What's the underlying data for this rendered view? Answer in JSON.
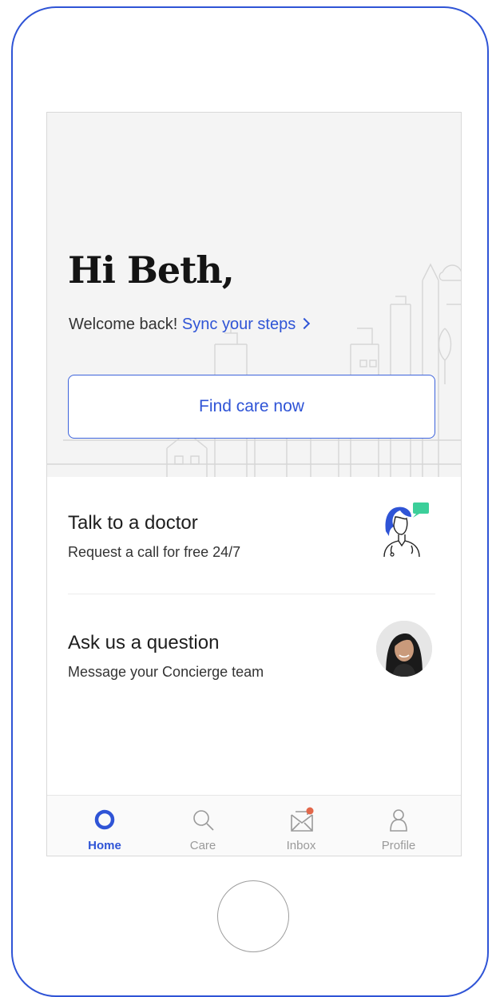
{
  "header": {
    "greeting": "Hi Beth,",
    "welcome_text": "Welcome back!",
    "sync_link": "Sync your steps"
  },
  "hero": {
    "find_care_label": "Find care now"
  },
  "cards": [
    {
      "title": "Talk to a doctor",
      "subtitle": "Request a call for free 24/7",
      "icon": "doctor-chat-icon"
    },
    {
      "title": "Ask us a question",
      "subtitle": "Message your Concierge team",
      "icon": "concierge-avatar"
    }
  ],
  "tabbar": {
    "items": [
      {
        "label": "Home",
        "icon": "home-ring-icon",
        "active": true
      },
      {
        "label": "Care",
        "icon": "search-icon",
        "active": false
      },
      {
        "label": "Inbox",
        "icon": "inbox-icon",
        "active": false,
        "badge": true
      },
      {
        "label": "Profile",
        "icon": "profile-icon",
        "active": false
      }
    ]
  },
  "colors": {
    "accent": "#2f54d6",
    "chat_bubble": "#3ccf9a",
    "inbox_badge": "#e2674a",
    "hero_bg": "#f4f4f4"
  }
}
